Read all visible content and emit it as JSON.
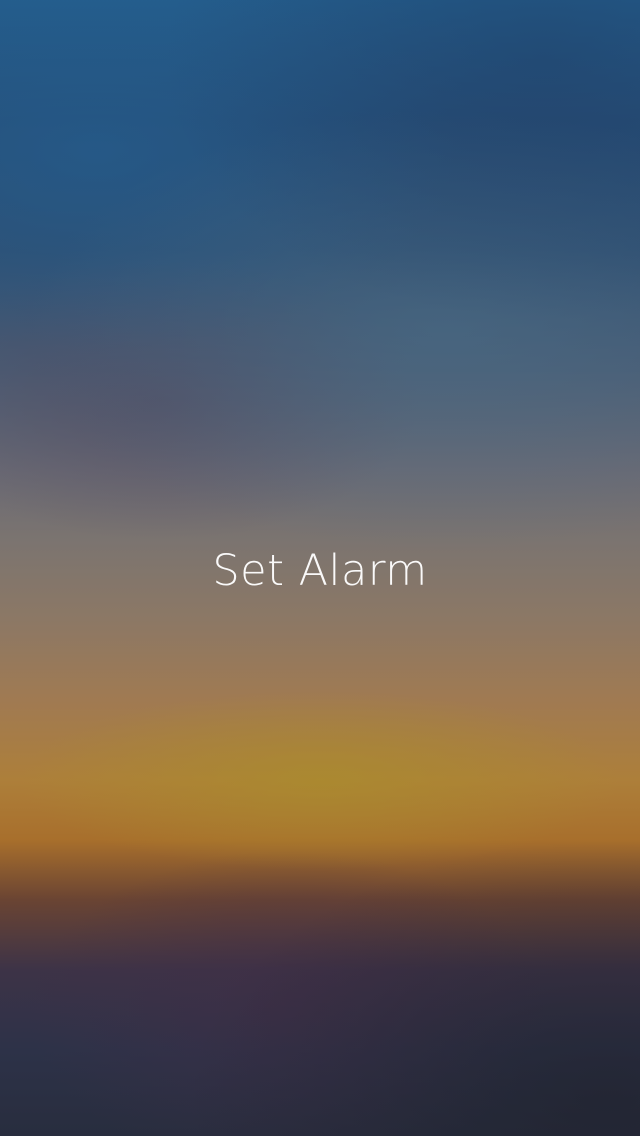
{
  "screen": {
    "title": "Set Alarm"
  }
}
